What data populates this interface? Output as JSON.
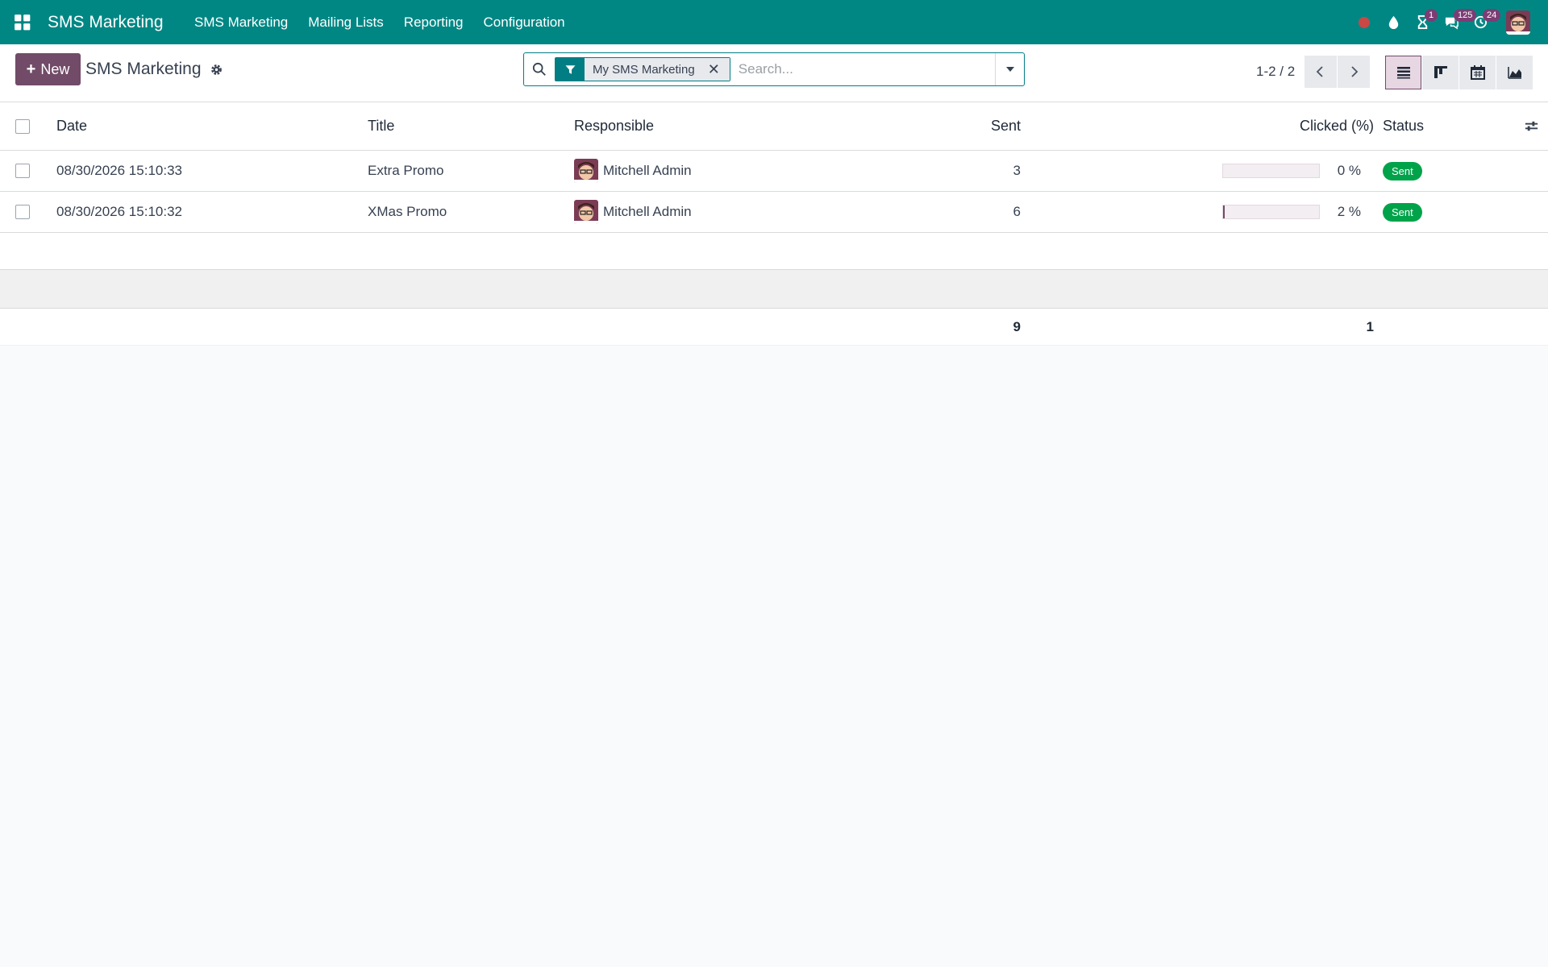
{
  "navbar": {
    "brand": "SMS Marketing",
    "menu": [
      "SMS Marketing",
      "Mailing Lists",
      "Reporting",
      "Configuration"
    ],
    "activity_badge": "1",
    "messages_badge": "125",
    "updates_badge": "24"
  },
  "control": {
    "new_label": "New",
    "breadcrumb": "SMS Marketing",
    "facet_label": "My SMS Marketing",
    "facet_close": "✕",
    "search_placeholder": "Search...",
    "pager": "1-2 / 2"
  },
  "table": {
    "headers": {
      "date": "Date",
      "title": "Title",
      "responsible": "Responsible",
      "sent": "Sent",
      "clicked": "Clicked (%)",
      "status": "Status"
    },
    "rows": [
      {
        "date": "08/30/2026 15:10:33",
        "title": "Extra Promo",
        "responsible": "Mitchell Admin",
        "sent": "3",
        "clicked_pct": "0 %",
        "clicked_value": 0,
        "status": "Sent"
      },
      {
        "date": "08/30/2026 15:10:32",
        "title": "XMas Promo",
        "responsible": "Mitchell Admin",
        "sent": "6",
        "clicked_pct": "2 %",
        "clicked_value": 2,
        "status": "Sent"
      }
    ],
    "totals": {
      "sent": "9",
      "clicked": "1"
    }
  },
  "colors": {
    "navbar": "#008784",
    "primary": "#714b67",
    "accent": "#017e84",
    "status_sent": "#00a34a"
  }
}
